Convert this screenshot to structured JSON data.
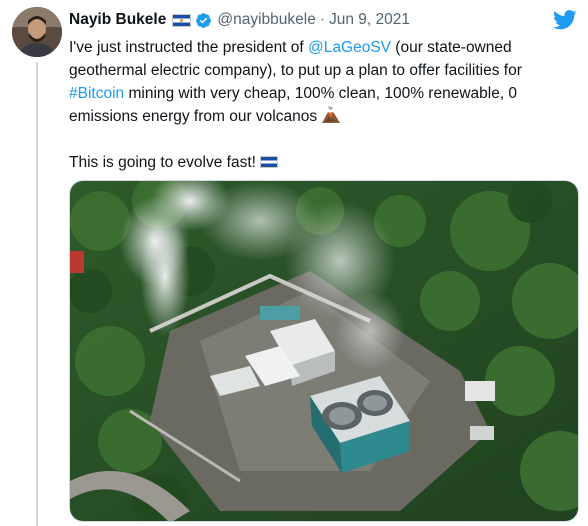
{
  "tweet": {
    "author_name": "Nayib Bukele",
    "handle": "@nayibbukele",
    "separator": "·",
    "date": "Jun 9, 2021",
    "text": {
      "l1_pre": "I've just instructed the president of ",
      "l1_mention": "@LaGeoSV",
      "l1_post": " (our state-owned",
      "l2": "geothermal electric company), to put up a plan to offer facilities for",
      "l3_hashtag": "#Bitcoin",
      "l3_post": " mining with very cheap, 100% clean, 100% renewable, 0",
      "l4": "emissions energy from our volcanos",
      "l5": "This is going to evolve fast!"
    }
  },
  "icons": {
    "author_flag": "el-salvador-flag-icon",
    "verified": "verified-badge-icon",
    "brand": "twitter-bird-icon",
    "volcano": "volcano-emoji-icon",
    "inline_flag": "el-salvador-flag-icon"
  },
  "media": {
    "image": "geothermal-plant-aerial-photo"
  },
  "colors": {
    "link": "#1d9bf0",
    "text": "#0f1419",
    "muted": "#536471",
    "brand": "#1d9bf0",
    "thread_line": "#cfd9de"
  }
}
